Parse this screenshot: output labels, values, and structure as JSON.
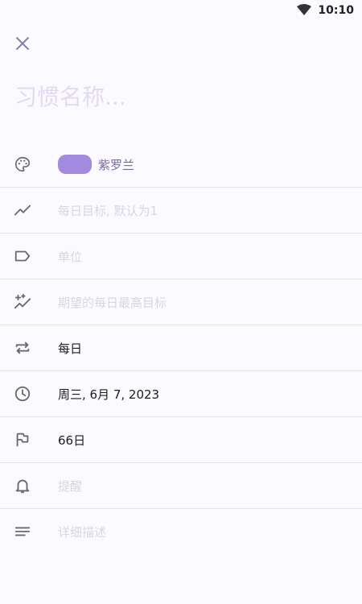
{
  "status_bar": {
    "time": "10:10"
  },
  "header": {
    "title_placeholder": "习惯名称..."
  },
  "colors": {
    "accent": "#a38ade",
    "icon": "#6b6870"
  },
  "rows": [
    {
      "id": "color",
      "icon": "palette-icon",
      "text": "紫罗兰",
      "is_placeholder": false
    },
    {
      "id": "daily-target",
      "icon": "trending-icon",
      "text": "每日目标, 默认为1",
      "is_placeholder": true
    },
    {
      "id": "unit",
      "icon": "label-icon",
      "text": "单位",
      "is_placeholder": true
    },
    {
      "id": "max-target",
      "icon": "sparkle-trend-icon",
      "text": "期望的每日最高目标",
      "is_placeholder": true
    },
    {
      "id": "frequency",
      "icon": "repeat-icon",
      "text": "每日",
      "is_placeholder": false
    },
    {
      "id": "start-date",
      "icon": "clock-icon",
      "text": "周三, 6月 7, 2023",
      "is_placeholder": false
    },
    {
      "id": "goal-days",
      "icon": "flag-icon",
      "text": "66日",
      "is_placeholder": false
    },
    {
      "id": "reminder",
      "icon": "bell-icon",
      "text": "提醒",
      "is_placeholder": true
    },
    {
      "id": "description",
      "icon": "notes-icon",
      "text": "详细描述",
      "is_placeholder": true
    }
  ]
}
